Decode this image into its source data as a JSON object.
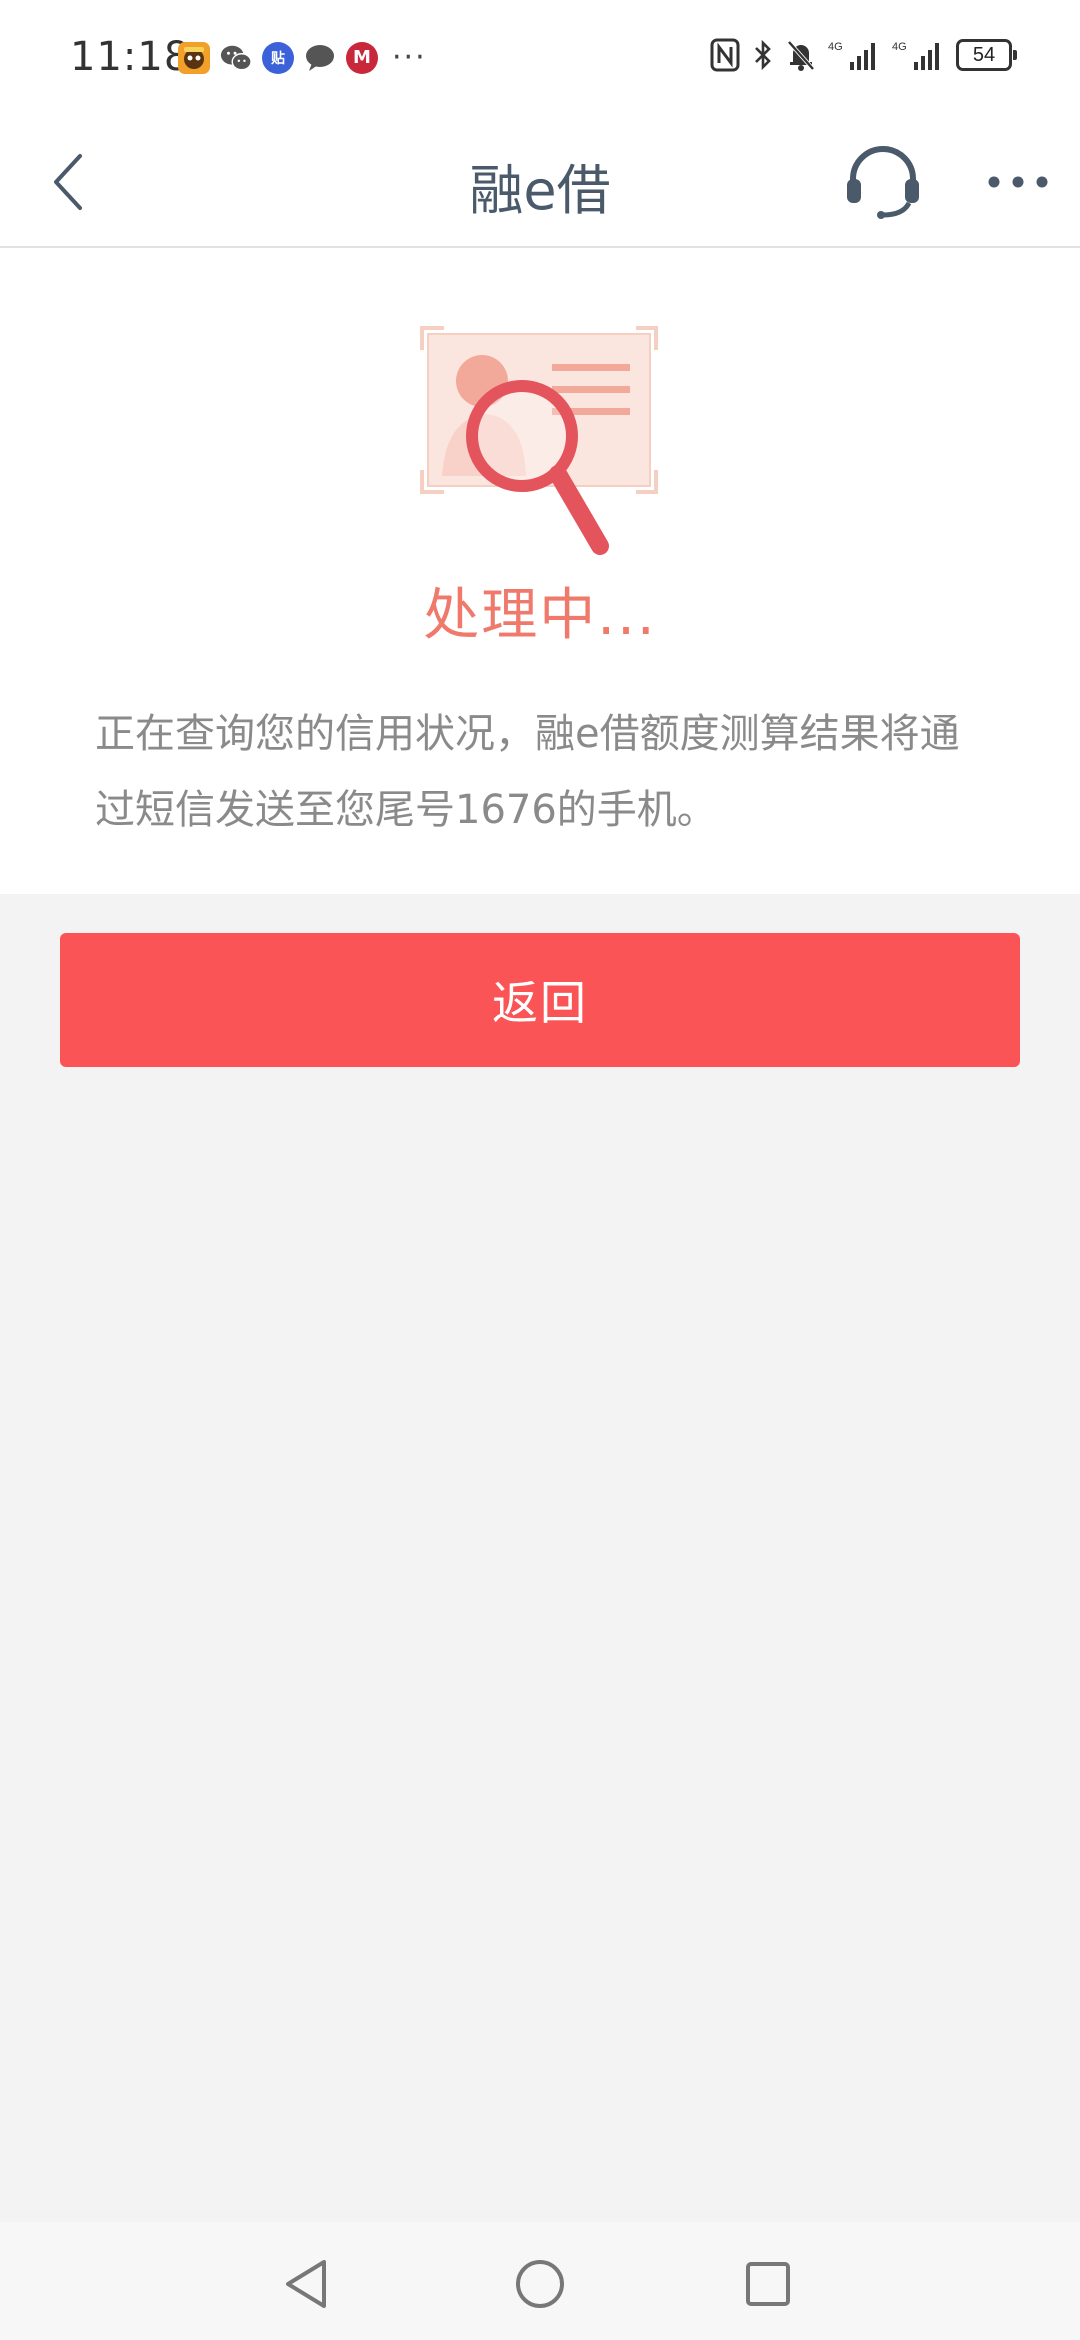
{
  "status_bar": {
    "time": "11:18",
    "notification_icons": [
      "monkey-app-icon",
      "wechat-icon",
      "tieba-icon",
      "message-icon",
      "cmb-bank-icon"
    ],
    "tieba_glyph": "贴",
    "cmb_glyph": "M",
    "more": "···",
    "network_labels": [
      "4G",
      "4G"
    ],
    "battery": "54"
  },
  "nav": {
    "title": "融e借",
    "back_icon": "chevron-left-icon",
    "service_icon": "headset-icon",
    "more_icon": "more-dots-icon"
  },
  "result": {
    "status_title": "处理中...",
    "description": "正在查询您的信用状况，融e借额度测算结果将通过短信发送至您尾号1676的手机。",
    "illustration_icon": "credit-check-magnifier-icon"
  },
  "actions": {
    "back_label": "返回"
  },
  "system_nav": {
    "back_icon": "triangle-back-icon",
    "home_icon": "circle-home-icon",
    "recents_icon": "square-recents-icon"
  },
  "colors": {
    "accent_red": "#fa5456",
    "status_title": "#ef7a6c",
    "nav_title": "#4a5a6a",
    "page_bg": "#f3f3f3"
  }
}
